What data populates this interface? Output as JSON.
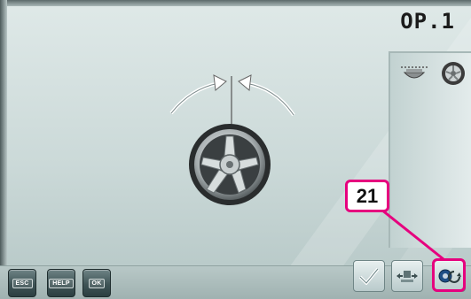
{
  "screen": {
    "operation_label": "OP.1"
  },
  "callout": {
    "number": "21",
    "color": "#e6007e"
  },
  "toolbar": {
    "esc_label": "ESC",
    "help_label": "HELP",
    "ok_label": "OK"
  },
  "icons": {
    "confirm": "checkmark-icon",
    "cycle": "arrows-cycle-icon",
    "rotate": "wheel-rotate-icon",
    "tyre_profile": "tyre-profile-icon",
    "wheel_small": "wheel-icon",
    "main_wheel": "alloy-wheel-icon",
    "arrows": "inward-arrows-icon"
  }
}
